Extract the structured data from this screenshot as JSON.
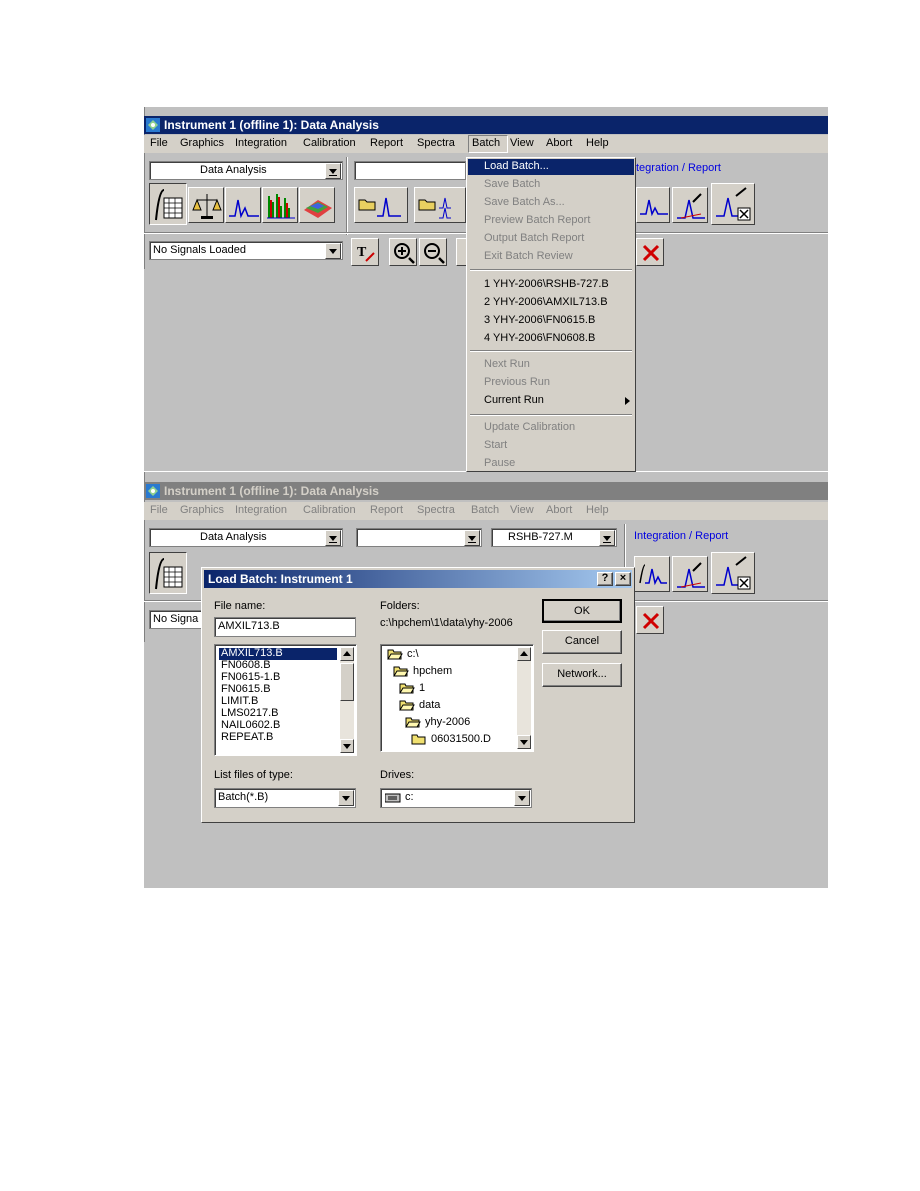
{
  "window_top": {
    "title": "Instrument 1 (offline 1): Data Analysis",
    "menu": [
      "File",
      "Graphics",
      "Integration",
      "Calibration",
      "Report",
      "Spectra",
      "Batch",
      "View",
      "Abort",
      "Help"
    ],
    "view_combo": "Data Analysis",
    "signals_combo": "No Signals Loaded",
    "integration_link": "tegration / Report"
  },
  "batch_menu": {
    "items": [
      {
        "label": "Load Batch...",
        "enabled": true,
        "highlighted": true
      },
      {
        "label": "Save Batch",
        "enabled": false
      },
      {
        "label": "Save Batch As...",
        "enabled": false
      },
      {
        "label": "Preview Batch Report",
        "enabled": false
      },
      {
        "label": "Output Batch Report",
        "enabled": false
      },
      {
        "label": "Exit Batch Review",
        "enabled": false
      }
    ],
    "recent": [
      "1 YHY-2006\\RSHB-727.B",
      "2 YHY-2006\\AMXIL713.B",
      "3 YHY-2006\\FN0615.B",
      "4 YHY-2006\\FN0608.B"
    ],
    "runs": [
      {
        "label": "Next Run",
        "enabled": false
      },
      {
        "label": "Previous Run",
        "enabled": false
      },
      {
        "label": "Current Run",
        "enabled": true,
        "submenu": true
      }
    ],
    "calibration": [
      {
        "label": "Update Calibration",
        "enabled": false
      },
      {
        "label": "Start",
        "enabled": false
      },
      {
        "label": "Pause",
        "enabled": false
      }
    ]
  },
  "window_bottom": {
    "title": "Instrument 1 (offline 1): Data Analysis",
    "menu": [
      "File",
      "Graphics",
      "Integration",
      "Calibration",
      "Report",
      "Spectra",
      "Batch",
      "View",
      "Abort",
      "Help"
    ],
    "view_combo": "Data Analysis",
    "method_combo": "RSHB-727.M",
    "signals_combo": "No Signa",
    "integration_link": "Integration / Report"
  },
  "dialog": {
    "title": "Load Batch: Instrument 1",
    "help_glyph": "?",
    "close_glyph": "×",
    "file_name_label": "File name:",
    "file_name_value": "AMXIL713.B",
    "files": [
      "AMXIL713.B",
      "FN0608.B",
      "FN0615-1.B",
      "FN0615.B",
      "LIMIT.B",
      "LMS0217.B",
      "NAIL0602.B",
      "REPEAT.B"
    ],
    "selected_file": "AMXIL713.B",
    "folders_label": "Folders:",
    "folders_path": "c:\\hpchem\\1\\data\\yhy-2006",
    "folders": [
      "c:\\",
      "hpchem",
      "1",
      "data",
      "yhy-2006",
      "06031500.D"
    ],
    "file_type_label": "List files of type:",
    "file_type_value": "Batch(*.B)",
    "drives_label": "Drives:",
    "drives_value": "c:",
    "ok_label": "OK",
    "cancel_label": "Cancel",
    "network_label": "Network..."
  }
}
